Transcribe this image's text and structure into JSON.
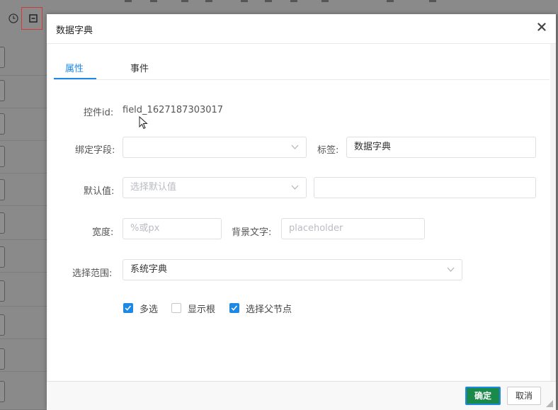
{
  "dialog": {
    "title": "数据字典",
    "tabs": [
      {
        "label": "属性"
      },
      {
        "label": "事件"
      }
    ],
    "control_id": {
      "label": "控件id:",
      "value": "field_1627187303017"
    },
    "bind_field": {
      "label": "绑定字段:",
      "value": ""
    },
    "tag": {
      "label": "标签:",
      "value": "数据字典"
    },
    "default_value": {
      "label": "默认值:",
      "placeholder": "选择默认值",
      "extra_value": ""
    },
    "width": {
      "label": "宽度:",
      "placeholder": "%或px"
    },
    "placeholder_text": {
      "label": "背景文字:",
      "placeholder": "placeholder"
    },
    "range": {
      "label": "选择范围:",
      "value": "系统字典"
    },
    "checkboxes": [
      {
        "label": "多选",
        "checked": true
      },
      {
        "label": "显示根",
        "checked": false
      },
      {
        "label": "选择父节点",
        "checked": true
      }
    ],
    "footer": {
      "ok": "确定",
      "cancel": "取消"
    }
  },
  "colors": {
    "accent": "#1e88e5",
    "ok_button": "#1a8a4a",
    "highlight": "#d23a3a"
  },
  "icons": [
    "clock-icon",
    "form-icon",
    "close-icon",
    "chevron-down-icon",
    "check-icon",
    "resize-grip-icon"
  ]
}
